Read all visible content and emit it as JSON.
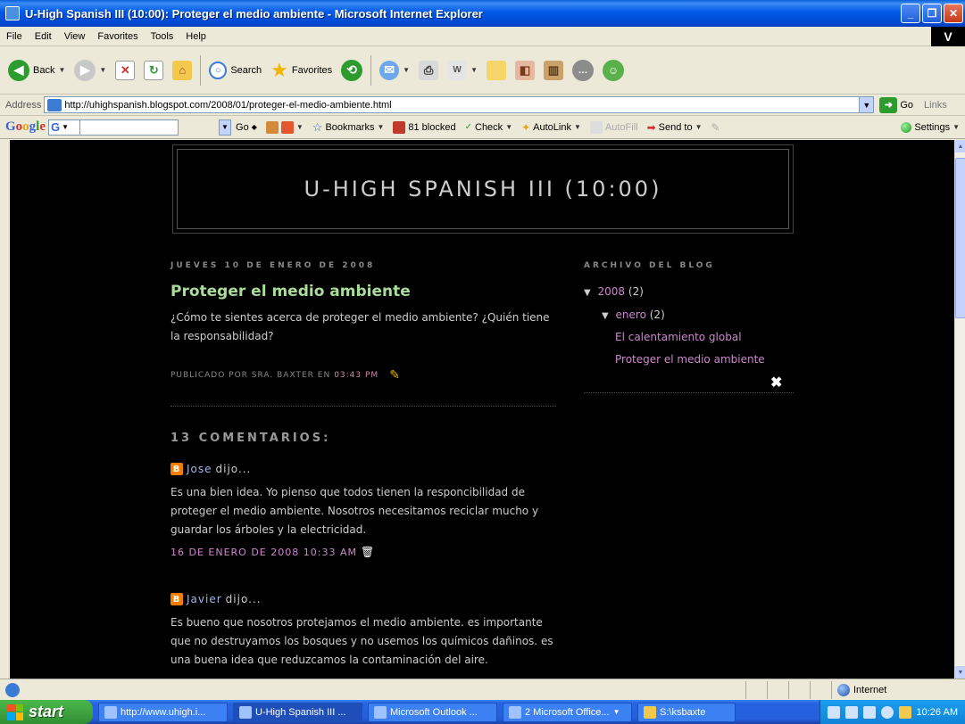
{
  "window": {
    "title": "U-High Spanish III (10:00): Proteger el medio ambiente - Microsoft Internet Explorer",
    "min": "_",
    "max": "❐",
    "close": "✕"
  },
  "menu": [
    "File",
    "Edit",
    "View",
    "Favorites",
    "Tools",
    "Help"
  ],
  "menu_logo": "V",
  "toolbar": {
    "back": "Back",
    "search": "Search",
    "favorites": "Favorites"
  },
  "address": {
    "label": "Address",
    "url": "http://uhighspanish.blogspot.com/2008/01/proteger-el-medio-ambiente.html",
    "go": "Go",
    "links": "Links"
  },
  "google_toolbar": {
    "logo_letters": [
      "G",
      "o",
      "o",
      "g",
      "l",
      "e"
    ],
    "g_button": "G",
    "go": "Go",
    "bookmarks": "Bookmarks",
    "blocked": "81 blocked",
    "check": "Check",
    "autolink": "AutoLink",
    "autofill": "AutoFill",
    "sendto": "Send to",
    "settings": "Settings"
  },
  "blog": {
    "title": "U-HIGH SPANISH III (10:00)",
    "post_date": "JUEVES 10 DE ENERO DE 2008",
    "post_title": "Proteger el medio ambiente",
    "post_body": "¿Cómo te sientes acerca de proteger el medio ambiente? ¿Quién tiene la responsabilidad?",
    "footer_prefix": "PUBLICADO POR SRA. BAXTER EN",
    "footer_time": "03:43 PM",
    "comments_heading": "13 COMENTARIOS:",
    "comments": [
      {
        "author": "Jose",
        "said": "dijo...",
        "body": "Es una bien idea. Yo pienso que todos tienen la responcibilidad de proteger el medio ambiente. Nosotros necesitamos reciclar mucho y guardar los árboles y la electricidad.",
        "timestamp": "16 DE ENERO DE 2008 10:33 AM"
      },
      {
        "author": "Javier",
        "said": "dijo...",
        "body": "Es bueno que nosotros protejamos el medio ambiente. es importante que no destruyamos los bosques y no usemos los químicos dañinos. es una buena idea que reduzcamos la contaminación del aire.",
        "timestamp": ""
      }
    ],
    "sidebar": {
      "heading": "ARCHIVO DEL BLOG",
      "year": "2008",
      "year_count": "(2)",
      "month": "enero",
      "month_count": "(2)",
      "posts": [
        "El calentamiento global",
        "Proteger el medio ambiente"
      ]
    }
  },
  "statusbar": {
    "zone": "Internet"
  },
  "taskbar": {
    "start": "start",
    "tasks": [
      "http://www.uhigh.i...",
      "U-High Spanish III ...",
      "Microsoft Outlook ...",
      "2 Microsoft Office...",
      "S:\\ksbaxte"
    ],
    "clock": "10:26 AM"
  },
  "colors": {
    "page_bg": "#000000",
    "post_title": "#aadd99",
    "link": "#cc88cc",
    "author_link": "#a1b6e8"
  }
}
